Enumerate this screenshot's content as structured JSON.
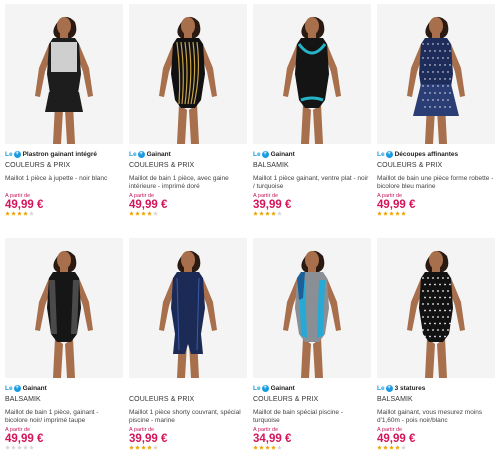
{
  "products": [
    {
      "badge_prefix": "Le",
      "badge_label": "Plastron gainant intégré",
      "brand": "COULEURS & PRIX",
      "title": "Maillot 1 pièce à jupette - noir blanc",
      "from_label": "A partir de",
      "price": "49,99 €",
      "rating": 4,
      "photo_colors": {
        "suit": "#1d1d1d",
        "pattern": "#cfcfcf",
        "accent": "#e8e8e8"
      },
      "photo_icon": "swimsuit-skirt-icon"
    },
    {
      "badge_prefix": "Le",
      "badge_label": "Gainant",
      "brand": "COULEURS & PRIX",
      "title": "Maillot de bain 1 pièce, avec gaine intérieure - imprimé doré",
      "from_label": "A partir de",
      "price": "49,99 €",
      "rating": 4,
      "photo_colors": {
        "suit": "#111111",
        "pattern": "#c9a24a",
        "accent": "#e7d49a"
      },
      "photo_icon": "swimsuit-gold-print-icon"
    },
    {
      "badge_prefix": "Le",
      "badge_label": "Gainant",
      "brand": "BALSAMIK",
      "title": "Maillot 1 pièce gainant, ventre plat - noir / turquoise",
      "from_label": "A partir de",
      "price": "39,99 €",
      "rating": 4,
      "photo_colors": {
        "suit": "#141414",
        "pattern": "#25b3c8",
        "accent": "#25b3c8"
      },
      "photo_icon": "swimsuit-turquoise-trim-icon"
    },
    {
      "badge_prefix": "Le",
      "badge_label": "Découpes affinantes",
      "brand": "COULEURS & PRIX",
      "title": "Maillot de bain une pièce forme robette - bicolore bleu marine",
      "from_label": "A partir de",
      "price": "49,99 €",
      "rating": 5,
      "photo_colors": {
        "suit": "#1e2c5a",
        "pattern": "#ffffff",
        "accent": "#2b3d75"
      },
      "photo_icon": "swimsuit-dress-dots-icon"
    },
    {
      "badge_prefix": "Le",
      "badge_label": "Gainant",
      "brand": "BALSAMIK",
      "title": "Maillot de bain 1 pièce, gainant - bicolore noir/ imprimé taupe",
      "from_label": "A partir de",
      "price": "49,99 €",
      "rating": 0,
      "photo_colors": {
        "suit": "#161616",
        "pattern": "#4a4a4a",
        "accent": "#2b2b2b"
      },
      "photo_icon": "swimsuit-mesh-icon"
    },
    {
      "badge_prefix": "",
      "badge_label": "",
      "brand": "COULEURS & PRIX",
      "title": "Maillot 1 pièce shorty couvrant, spécial piscine - marine",
      "from_label": "A partir de",
      "price": "39,99 €",
      "rating": 4,
      "photo_colors": {
        "suit": "#1c2b55",
        "pattern": "#3a5aa8",
        "accent": "#2a3d78"
      },
      "photo_icon": "swimsuit-shorty-icon"
    },
    {
      "badge_prefix": "Le",
      "badge_label": "Gainant",
      "brand": "COULEURS & PRIX",
      "title": "Maillot de bain spécial piscine - turquoise",
      "from_label": "A partir de",
      "price": "34,99 €",
      "rating": 4,
      "photo_colors": {
        "suit": "#8a8f96",
        "pattern": "#27a9d6",
        "accent": "#1c5f99"
      },
      "photo_icon": "swimsuit-sport-icon"
    },
    {
      "badge_prefix": "Le",
      "badge_label": "3 statures",
      "brand": "BALSAMIK",
      "title": "Maillot gainant, vous mesurez moins d'1,60m - pois noir/blanc",
      "from_label": "A partir de",
      "price": "49,99 €",
      "rating": 4,
      "photo_colors": {
        "suit": "#121212",
        "pattern": "#f5f5f5",
        "accent": "#2a2a2a"
      },
      "photo_icon": "swimsuit-polka-icon"
    }
  ],
  "colors": {
    "price": "#d4145a",
    "badge_blue": "#1a9be0",
    "star_on": "#f0a400",
    "star_off": "#d6d6d6",
    "skin": "#a86f4c",
    "hair": "#2a1a12"
  }
}
